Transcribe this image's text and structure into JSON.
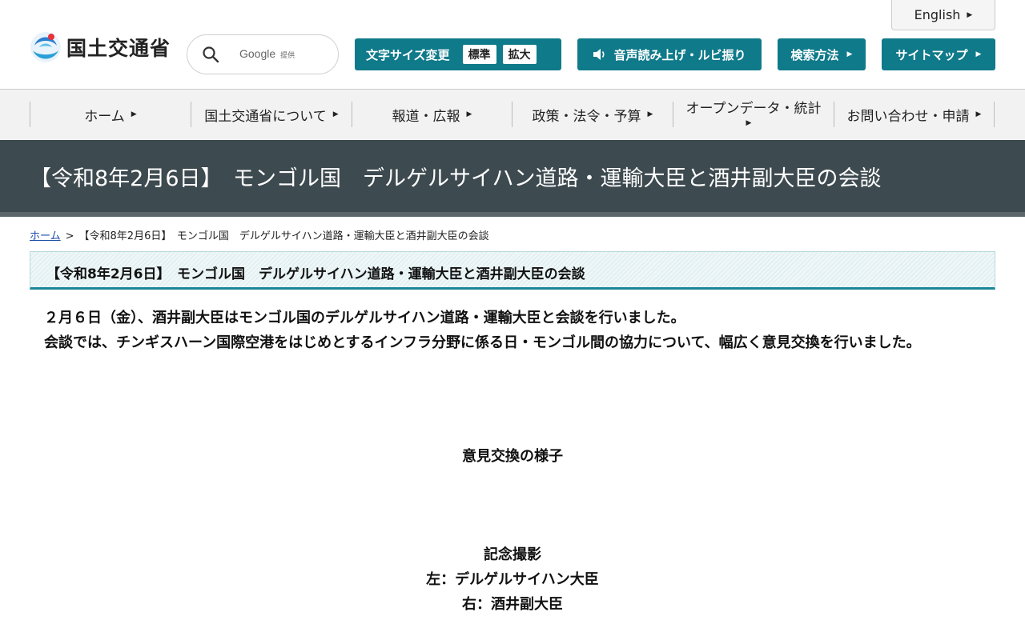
{
  "header": {
    "logo_text": "国土交通省",
    "search": {
      "brand": "Google",
      "brand_suffix": "提供",
      "placeholder": ""
    },
    "english_label": "English",
    "font_size": {
      "label": "文字サイズ変更",
      "standard": "標準",
      "large": "拡大"
    },
    "speech_label": "音声読み上げ・ルビ振り",
    "search_method_label": "検索方法",
    "sitemap_label": "サイトマップ"
  },
  "nav": {
    "items": [
      {
        "label": "ホーム"
      },
      {
        "label": "国土交通省について"
      },
      {
        "label": "報道・広報"
      },
      {
        "label": "政策・法令・予算"
      },
      {
        "label": "オープンデータ・統計"
      },
      {
        "label": "お問い合わせ・申請"
      }
    ]
  },
  "page": {
    "title": "【令和8年2月6日】　モンゴル国　デルゲルサイハン道路・運輸大臣と酒井副大臣の会談",
    "breadcrumb": {
      "home": "ホーム",
      "separator": ">",
      "current": "【令和8年2月6日】　モンゴル国　デルゲルサイハン道路・運輸大臣と酒井副大臣の会談"
    },
    "heading": "【令和8年2月6日】　モンゴル国　デルゲルサイハン道路・運輸大臣と酒井副大臣の会談",
    "paragraph1": "２月６日（金）、酒井副大臣はモンゴル国のデルゲルサイハン道路・運輸大臣と会談を行いました。",
    "paragraph2": "会談では、チンギスハーン国際空港をはじめとするインフラ分野に係る日・モンゴル間の協力について、幅広く意見交換を行いました。",
    "caption1": "意見交換の様子",
    "caption2_line1": "記念撮影",
    "caption2_line2": "左：デルゲルサイハン大臣",
    "caption2_line3": "右：酒井副大臣"
  },
  "colors": {
    "teal": "#0f7a8a",
    "banner": "#3d4a4f",
    "nav_bg": "#f2f2f2"
  }
}
